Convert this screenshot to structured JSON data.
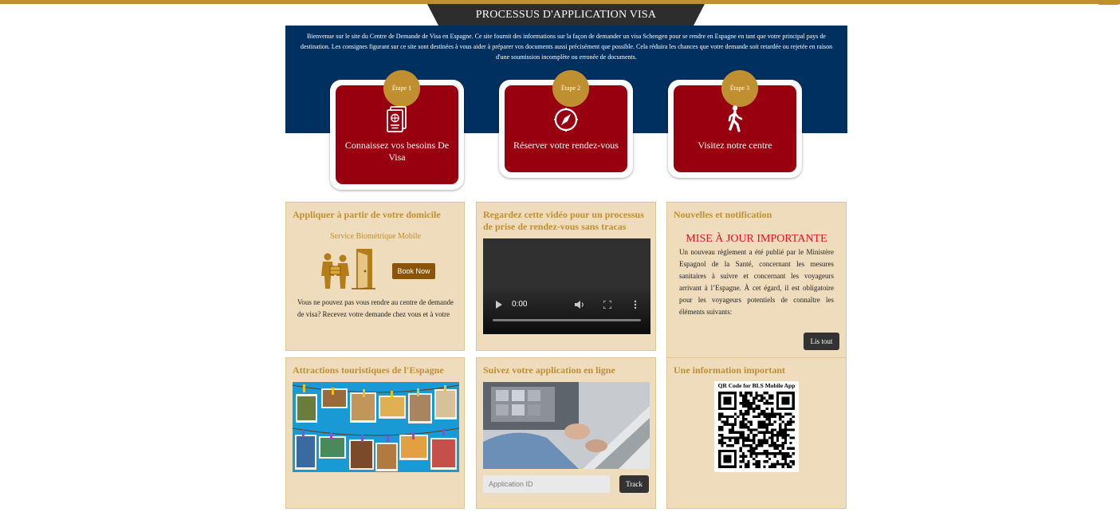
{
  "header": {
    "title": "PROCESSUS D'APPLICATION VISA",
    "accent_color": "#c09030",
    "banner_color": "#003060"
  },
  "intro": {
    "text": "Bienvenue sur le site du Centre de Demande de Visa en Espagne. Ce site fournit des informations sur la façon de demander un visa Schengen pour se rendre en Espagne en tant que votre principal pays de destination. Les consignes figurant sur ce site sont destinées à vous aider à préparer vos documents aussi précisément que possible. Cela réduira les chances que votre demande soit retardée ou rejetée en raison d'une soumission incomplète ou erronée de documents."
  },
  "steps": [
    {
      "badge": "Étape 1",
      "label": "Connaissez vos besoins De Visa",
      "icon": "passport-icon"
    },
    {
      "badge": "Étape 2",
      "label": "Réserver votre rendez-vous",
      "icon": "compass-icon"
    },
    {
      "badge": "Étape 3",
      "label": "Visitez notre centre",
      "icon": "walking-person-icon"
    }
  ],
  "home_card": {
    "title": "Appliquer à partir de votre domicile",
    "service_title": "Service Biométrique Mobile",
    "book_label": "Book Now",
    "text": "Vous ne pouvez pas vous rendre au centre de demande de visa? Recevez votre demande chez vous et à votre"
  },
  "video_card": {
    "title": "Regardez cette vidéo pour un processus de prise de rendez-vous sans tracas",
    "time": "0:00",
    "progress": 0
  },
  "news_card": {
    "title": "Nouvelles et notification",
    "alert_title": "MISE À JOUR IMPORTANTE",
    "text": "Un nouveau règlement a été publié par le Ministère Espagnol de la Santé, concernant les mesures sanitaires à suivre et concernant les voyageurs arrivant à l’Espagne. À cet égard, il est obligatoire pour les voyageurs potentiels de connaître les éléments suivants:",
    "read_all_label": "Lis tout"
  },
  "tourism_card": {
    "title": "Attractions touristiques de l'Espagne"
  },
  "track_card": {
    "title": "Suivez votre application en ligne",
    "input_placeholder": "Application ID",
    "track_label": "Track"
  },
  "info_card": {
    "title": "Une information important",
    "qr_caption": "QR Code for BLS Mobile App"
  }
}
